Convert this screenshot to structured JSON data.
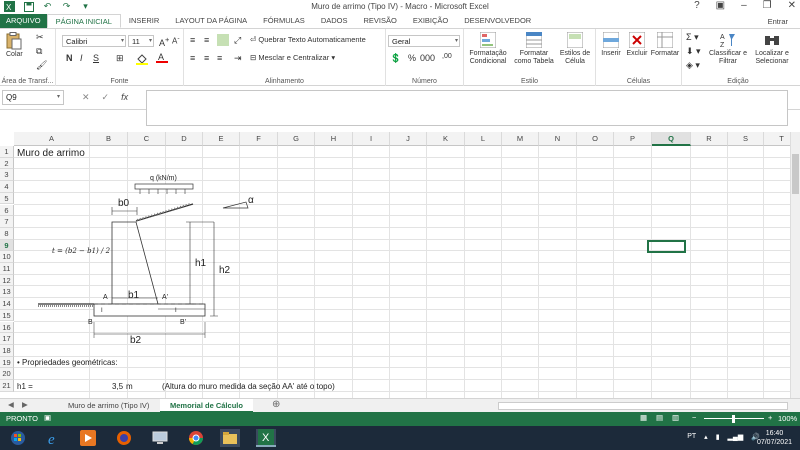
{
  "window": {
    "title": "Muro de arrimo (Tipo IV) - Macro - Microsoft Excel",
    "help": "?",
    "signin": "Entrar"
  },
  "tabs": [
    "ARQUIVO",
    "PÁGINA INICIAL",
    "INSERIR",
    "LAYOUT DA PÁGINA",
    "FÓRMULAS",
    "DADOS",
    "REVISÃO",
    "EXIBIÇÃO",
    "DESENVOLVEDOR"
  ],
  "ribbon": {
    "clipboard": {
      "paste": "Colar",
      "label": "Área de Transf..."
    },
    "font": {
      "name": "Calibri",
      "size": "11",
      "bold": "N",
      "italic": "I",
      "underline": "S",
      "label": "Fonte"
    },
    "alignment": {
      "wrap": "Quebrar Texto Automaticamente",
      "merge": "Mesclar e Centralizar",
      "label": "Alinhamento"
    },
    "number": {
      "format": "Geral",
      "label": "Número"
    },
    "styles": {
      "cond": "Formatação Condicional",
      "table": "Formatar como Tabela",
      "cell": "Estilos de Célula",
      "label": "Estilo"
    },
    "cells": {
      "insert": "Inserir",
      "delete": "Excluir",
      "format": "Formatar",
      "label": "Células"
    },
    "editing": {
      "sort": "Classificar e Filtrar",
      "find": "Localizar e Selecionar",
      "label": "Edição"
    }
  },
  "formula_bar": {
    "name_box": "Q9",
    "fx": "fx",
    "value": ""
  },
  "columns": [
    "A",
    "B",
    "C",
    "D",
    "E",
    "F",
    "G",
    "H",
    "I",
    "J",
    "K",
    "L",
    "M",
    "N",
    "O",
    "P",
    "Q",
    "R",
    "S",
    "T"
  ],
  "rows": [
    "1",
    "2",
    "3",
    "4",
    "5",
    "6",
    "7",
    "8",
    "9",
    "10",
    "11",
    "12",
    "13",
    "14",
    "15",
    "16",
    "17",
    "18",
    "19",
    "20",
    "21"
  ],
  "cells": {
    "a1": "Muro de arrimo",
    "a19": "• Propriedades geométricas:",
    "a21": "h1 =",
    "b21": "3,5",
    "c21": "m",
    "d21": "(Altura do muro medida da seção AA' até o topo)"
  },
  "diagram": {
    "q": "q (kN/m)",
    "b0": "b0",
    "alpha": "α",
    "h1": "h1",
    "h2": "h2",
    "b1": "b1",
    "b2": "b2",
    "A": "A",
    "Aprime": "A'",
    "B": "B",
    "Bprime": "B'",
    "t_eq": "t = (b2 − b1) / 2",
    "one_a": "I",
    "one_b": "I"
  },
  "sheets": [
    "Muro de arrimo (Tipo IV)",
    "Memorial de Cálculo"
  ],
  "status": {
    "mode": "PRONTO",
    "zoom": "100%"
  },
  "taskbar": {
    "lang": "PT",
    "time": "16:40",
    "date": "07/07/2021"
  },
  "colors": {
    "excel_green": "#217346"
  }
}
